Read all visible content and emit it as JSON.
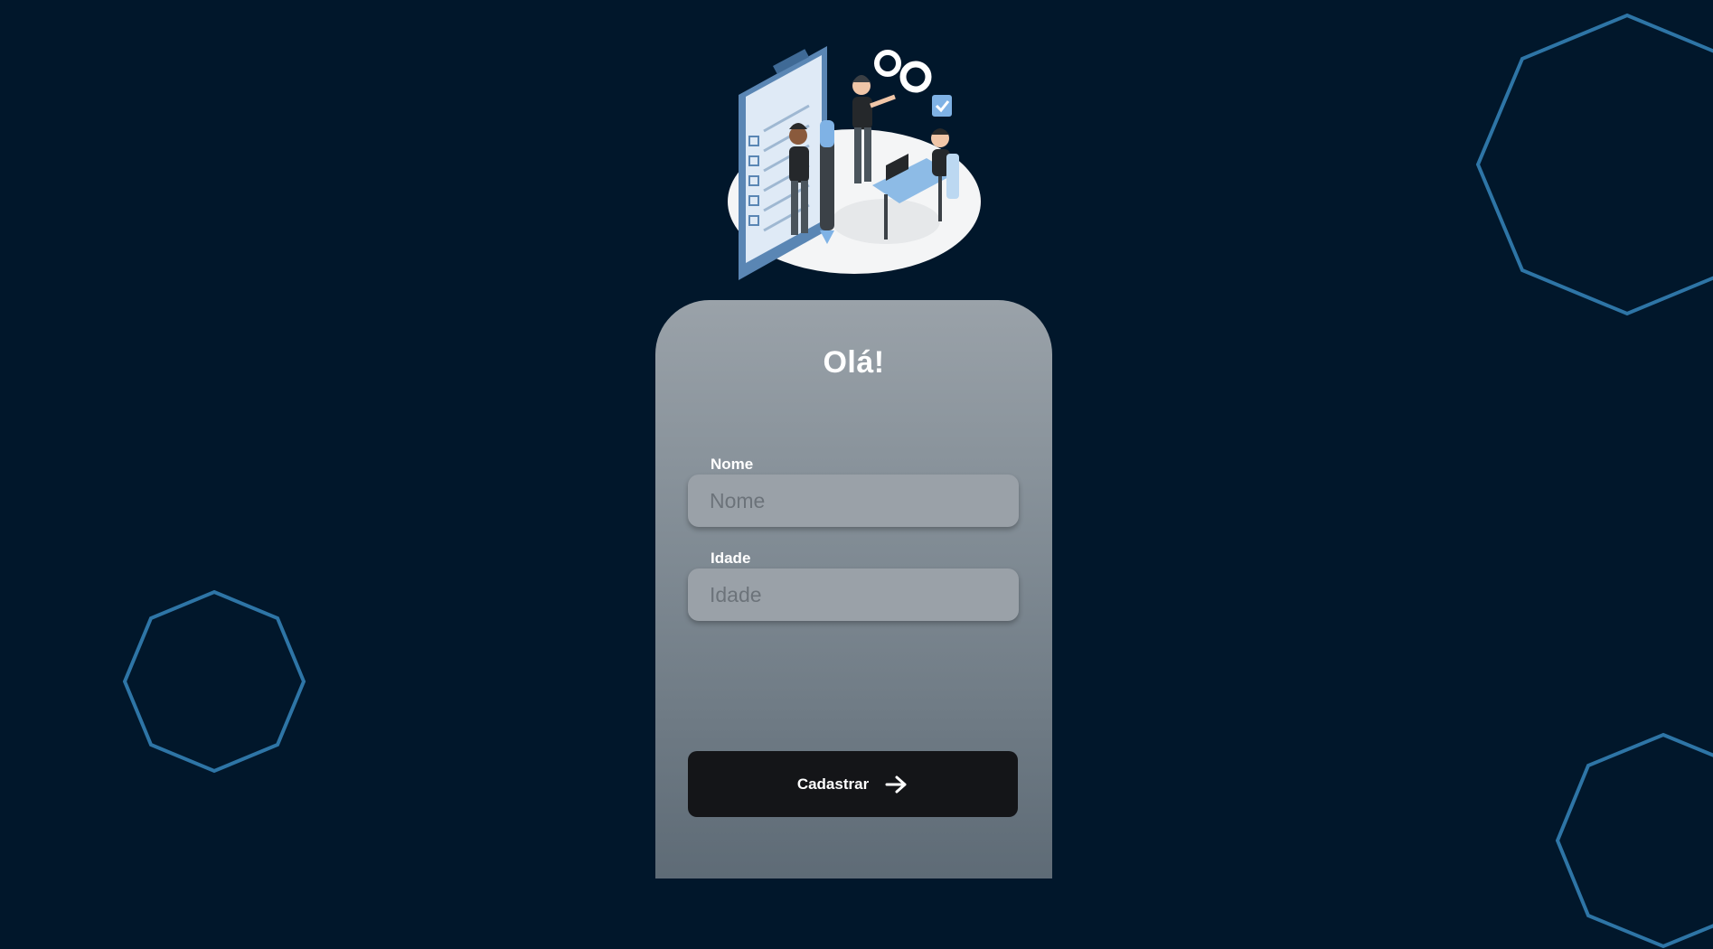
{
  "theme": {
    "background": "#01172b",
    "shape_stroke": "#2e75a6",
    "card_gradient_top": "#9aa2a9",
    "card_gradient_bottom": "#5e6b76",
    "button_bg": "#141518"
  },
  "illustration": {
    "icon": "team-planning-illustration"
  },
  "form": {
    "title": "Olá!",
    "fields": [
      {
        "label": "Nome",
        "placeholder": "Nome",
        "value": ""
      },
      {
        "label": "Idade",
        "placeholder": "Idade",
        "value": ""
      }
    ],
    "submit_label": "Cadastrar",
    "submit_icon": "arrow-right-icon"
  }
}
